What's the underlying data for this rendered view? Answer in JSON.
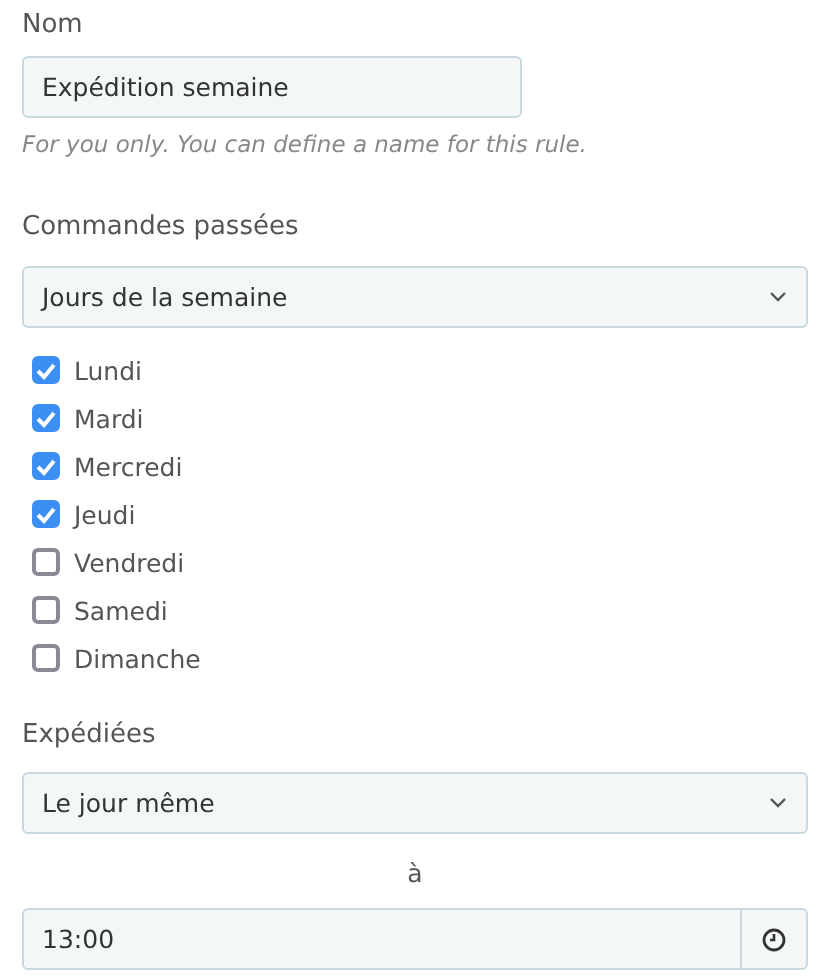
{
  "name_field": {
    "label": "Nom",
    "value": "Expédition semaine",
    "hint": "For you only. You can define a name for this rule."
  },
  "orders": {
    "label": "Commandes passées",
    "value": "Jours de la semaine",
    "days": [
      {
        "label": "Lundi",
        "checked": true
      },
      {
        "label": "Mardi",
        "checked": true
      },
      {
        "label": "Mercredi",
        "checked": true
      },
      {
        "label": "Jeudi",
        "checked": true
      },
      {
        "label": "Vendredi",
        "checked": false
      },
      {
        "label": "Samedi",
        "checked": false
      },
      {
        "label": "Dimanche",
        "checked": false
      }
    ]
  },
  "shipped": {
    "label": "Expédiées",
    "value": "Le jour même",
    "at": "à",
    "time": "13:00"
  }
}
